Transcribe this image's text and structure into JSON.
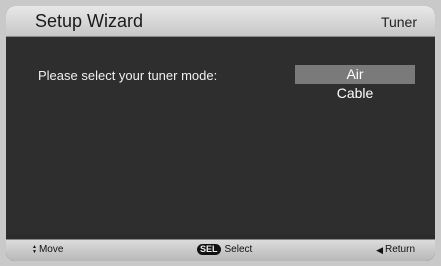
{
  "header": {
    "title": "Setup Wizard",
    "screen": "Tuner"
  },
  "main": {
    "prompt": "Please select your tuner mode:",
    "options": [
      {
        "label": "Air",
        "selected": true
      },
      {
        "label": "Cable",
        "selected": false
      }
    ]
  },
  "footer": {
    "move_label": "Move",
    "move_icon": "up-down-arrows-icon",
    "select_key": "SEL",
    "select_label": "Select",
    "return_label": "Return",
    "return_icon": "left-triangle-icon"
  },
  "colors": {
    "header_bg": "#d8d8d8",
    "content_bg": "#2e2e2e",
    "highlight": "#7a7a7a",
    "text": "#ffffff"
  }
}
